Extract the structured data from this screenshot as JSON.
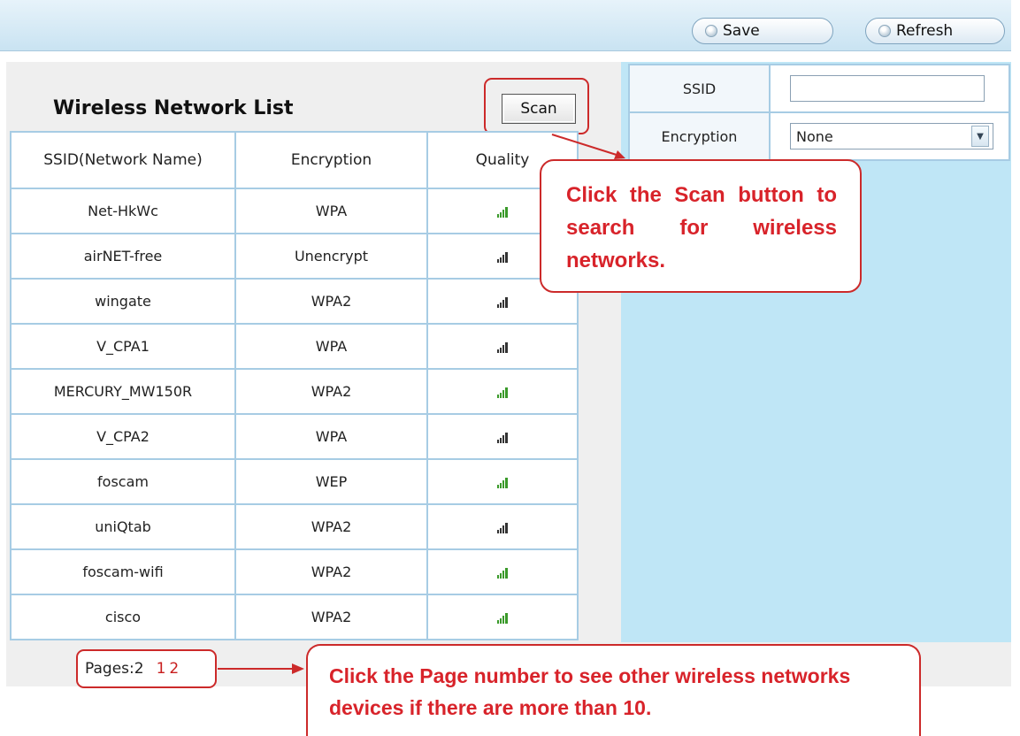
{
  "toolbar": {
    "save_label": "Save",
    "refresh_label": "Refresh"
  },
  "list": {
    "title": "Wireless Network List",
    "scan_label": "Scan",
    "columns": [
      "SSID(Network Name)",
      "Encryption",
      "Quality"
    ],
    "rows": [
      {
        "ssid": "Net-HkWc",
        "encryption": "WPA",
        "quality": "strong"
      },
      {
        "ssid": "airNET-free",
        "encryption": "Unencrypt",
        "quality": "weak"
      },
      {
        "ssid": "wingate",
        "encryption": "WPA2",
        "quality": "weak"
      },
      {
        "ssid": "V_CPA1",
        "encryption": "WPA",
        "quality": "weak"
      },
      {
        "ssid": "MERCURY_MW150R",
        "encryption": "WPA2",
        "quality": "strong"
      },
      {
        "ssid": "V_CPA2",
        "encryption": "WPA",
        "quality": "weak"
      },
      {
        "ssid": "foscam",
        "encryption": "WEP",
        "quality": "strong"
      },
      {
        "ssid": "uniQtab",
        "encryption": "WPA2",
        "quality": "weak"
      },
      {
        "ssid": "foscam-wifi",
        "encryption": "WPA2",
        "quality": "strong"
      },
      {
        "ssid": "cisco",
        "encryption": "WPA2",
        "quality": "strong"
      }
    ],
    "pages_label": "Pages:2",
    "page_numbers": [
      "1",
      "2"
    ]
  },
  "form": {
    "ssid_label": "SSID",
    "ssid_value": "",
    "encryption_label": "Encryption",
    "encryption_value": "None"
  },
  "callouts": {
    "scan": "Click the Scan button to search for wireless networks.",
    "page": "Click the Page number to see other wireless networks devices if there are more than 10."
  },
  "colors": {
    "accent_red": "#cc2a2a",
    "panel_blue": "#bfe6f6",
    "signal_strong": "#3a9a2a",
    "signal_weak": "#333333"
  }
}
